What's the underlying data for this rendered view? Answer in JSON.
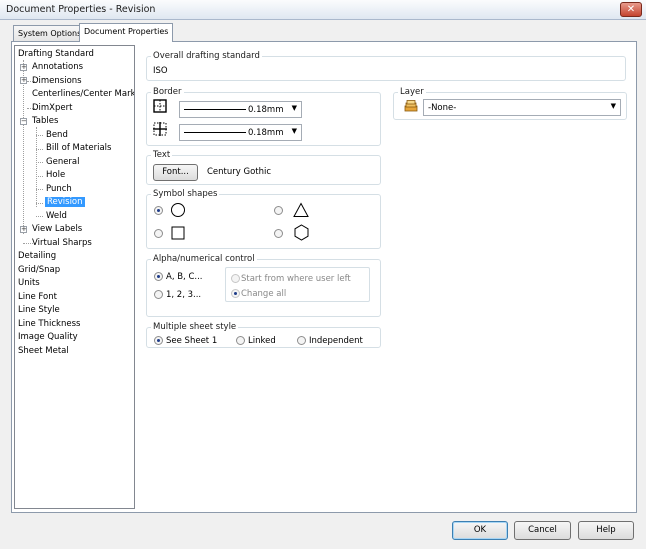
{
  "window": {
    "title": "Document Properties - Revision",
    "close_symbol": "✕"
  },
  "tabs": [
    {
      "label": "System Options"
    },
    {
      "label": "Document Properties"
    }
  ],
  "tree": {
    "items": [
      {
        "label": "Drafting Standard"
      },
      {
        "label": "Annotations"
      },
      {
        "label": "Dimensions"
      },
      {
        "label": "Centerlines/Center Marks"
      },
      {
        "label": "DimXpert"
      },
      {
        "label": "Tables"
      },
      {
        "label": "Bend"
      },
      {
        "label": "Bill of Materials"
      },
      {
        "label": "General"
      },
      {
        "label": "Hole"
      },
      {
        "label": "Punch"
      },
      {
        "label": "Revision"
      },
      {
        "label": "Weld"
      },
      {
        "label": "View Labels"
      },
      {
        "label": "Virtual Sharps"
      },
      {
        "label": "Detailing"
      },
      {
        "label": "Grid/Snap"
      },
      {
        "label": "Units"
      },
      {
        "label": "Line Font"
      },
      {
        "label": "Line Style"
      },
      {
        "label": "Line Thickness"
      },
      {
        "label": "Image Quality"
      },
      {
        "label": "Sheet Metal"
      }
    ],
    "selected": "Revision"
  },
  "overall": {
    "label": "Overall drafting standard",
    "value": "ISO"
  },
  "border": {
    "label": "Border",
    "outer_thickness": "0.18mm",
    "inner_thickness": "0.18mm"
  },
  "layer": {
    "label": "Layer",
    "value": "-None-"
  },
  "text": {
    "label": "Text",
    "font_button": "Font...",
    "font_name": "Century Gothic"
  },
  "symbol_shapes": {
    "label": "Symbol shapes",
    "selected": "circle"
  },
  "alpha": {
    "label": "Alpha/numerical control",
    "option_alpha": "A, B, C...",
    "option_numeric": "1, 2, 3...",
    "option_start": "Start from where user left",
    "option_change": "Change all"
  },
  "multi_sheet": {
    "label": "Multiple sheet style",
    "option_see": "See Sheet 1",
    "option_linked": "Linked",
    "option_independent": "Independent"
  },
  "buttons": {
    "ok": "OK",
    "cancel": "Cancel",
    "help": "Help"
  },
  "colors": {
    "selection": "#3399ff",
    "panel": "#ffffff",
    "chrome": "#f0f0f0"
  }
}
